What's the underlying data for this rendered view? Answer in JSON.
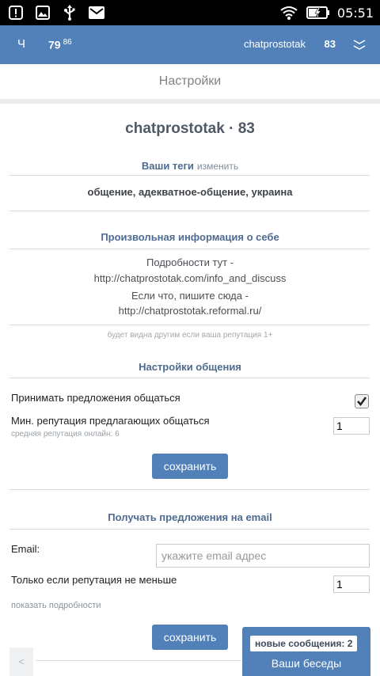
{
  "status_bar": {
    "time": "05:51"
  },
  "app_bar": {
    "tab_letter": "Ч",
    "score": "79",
    "score_sup": "86",
    "username": "chatprostotak",
    "reputation": "83"
  },
  "subheader": {
    "title": "Настройки"
  },
  "profile": {
    "title": "chatprostotak · 83"
  },
  "tags": {
    "header": "Ваши теги",
    "edit_link": "изменить",
    "value": "общение, адекватное-общение, украина"
  },
  "about": {
    "header": "Произвольная информация о себе",
    "line1": "Подробности тут -",
    "line2": "http://chatprostotak.com/info_and_discuss",
    "line3": "Если что, пишите сюда -",
    "line4": "http://chatprostotak.reformal.ru/",
    "note": "будет видна другим если ваша репутация 1+"
  },
  "chat_settings": {
    "header": "Настройки общения",
    "accept_label": "Принимать предложения общаться",
    "accept_checked": true,
    "min_rep_label": "Мин. репутация предлагающих общаться",
    "min_rep_hint": "средняя репутация онлайн: 6",
    "min_rep_value": "1",
    "save_label": "сохранить"
  },
  "email_section": {
    "header": "Получать предложения на email",
    "email_label": "Email:",
    "email_placeholder": "укажите email адрес",
    "rep_label": "Только если репутация не меньше",
    "rep_value": "1",
    "details_link": "показать подробности",
    "save_label": "сохранить"
  },
  "footer": {
    "back_label": "<",
    "new_messages": "новые сообщения: 2",
    "conversations": "Ваши беседы"
  }
}
